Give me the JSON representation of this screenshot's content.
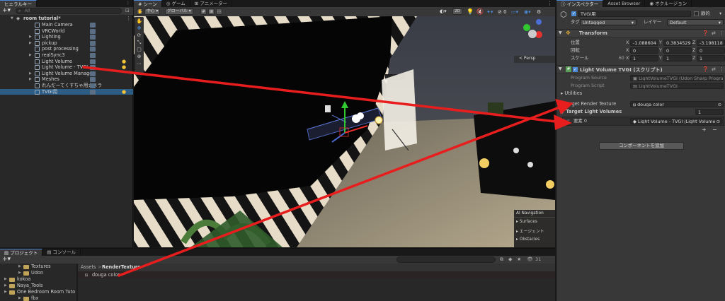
{
  "hierarchy": {
    "tab": "ヒエラルキー",
    "search_placeholder": "All",
    "scene_name": "room tutorial*",
    "items": [
      {
        "label": "Main Camera",
        "indent": 2,
        "fold": "",
        "bulb": false
      },
      {
        "label": "VRCWorld",
        "indent": 2,
        "fold": "",
        "bulb": false
      },
      {
        "label": "Lighting",
        "indent": 2,
        "fold": "▶",
        "bulb": false
      },
      {
        "label": "pickup",
        "indent": 2,
        "fold": "▶",
        "bulb": false
      },
      {
        "label": "post processing",
        "indent": 2,
        "fold": "",
        "bulb": false
      },
      {
        "label": "realSync3",
        "indent": 2,
        "fold": "▶",
        "bulb": false
      },
      {
        "label": "Light Volume",
        "indent": 2,
        "fold": "",
        "bulb": true
      },
      {
        "label": "Light Volume - TVGI",
        "indent": 2,
        "fold": "",
        "bulb": true
      },
      {
        "label": "Light Volume Manager",
        "indent": 2,
        "fold": "▶",
        "bulb": false
      },
      {
        "label": "Meshes",
        "indent": 2,
        "fold": "▶",
        "bulb": false
      },
      {
        "label": "れんだーてくすちゃ用カメラ",
        "indent": 2,
        "fold": "",
        "bulb": false
      },
      {
        "label": "TVGI用",
        "indent": 2,
        "fold": "",
        "bulb": true,
        "selected": true
      }
    ]
  },
  "scene": {
    "tabs": [
      "シーン",
      "ゲーム",
      "アニメーター"
    ],
    "toolbar": {
      "pivot": "中心",
      "space": "グローバル",
      "mode_2d": "2D"
    },
    "persp_label": "< Persp",
    "ai_nav": {
      "title": "AI Navigation",
      "items": [
        "Surfaces",
        "エージェント",
        "Obstacles"
      ]
    }
  },
  "inspector": {
    "tabs": [
      "インスペクター",
      "Asset Browser",
      "オクルージョン"
    ],
    "object_name": "TVGI用",
    "static_label": "静的",
    "tag_label": "タグ",
    "tag_value": "Untagged",
    "layer_label": "レイヤー",
    "layer_value": "Default",
    "transform": {
      "title": "Transform",
      "position_label": "位置",
      "rotation_label": "回転",
      "scale_label": "スケール",
      "position": [
        "-1.088604",
        "0.3834529",
        "-3.198118"
      ],
      "rotation": [
        "0",
        "0",
        "0"
      ],
      "scale": [
        "1",
        "1",
        "1"
      ],
      "scale_prefix": "60",
      "axes": [
        "X",
        "Y",
        "Z"
      ]
    },
    "component": {
      "title": "Light Volume TVGI (スクリプト)",
      "program_source_label": "Program Source",
      "program_source_value": "LightVolumeTVGI (Udon Sharp Progra",
      "program_script_label": "Program Script",
      "program_script_value": "LightVolumeTVGI",
      "utilities_label": "Utilities",
      "target_rt_label": "Target Render Texture",
      "target_rt_value": "douga color",
      "target_lv_label": "Target Light Volumes",
      "target_lv_count": "1",
      "element_label": "要素 0",
      "element_value": "Light Volume - TVGI (Light Volume"
    },
    "add_component": "コンポーネントを追加"
  },
  "project": {
    "tabs": [
      "プロジェクト",
      "コンソール"
    ],
    "tree": [
      {
        "label": "Textures",
        "indent": 2
      },
      {
        "label": "Udon",
        "indent": 2
      },
      {
        "label": "kokoa",
        "indent": 0
      },
      {
        "label": "Naya_Tools",
        "indent": 0
      },
      {
        "label": "One Bedroom Room Tuto",
        "indent": 0
      },
      {
        "label": "fbx",
        "indent": 2
      }
    ],
    "breadcrumb": [
      "Assets",
      "RenderTexture"
    ],
    "asset": "douga color",
    "count": "31"
  },
  "colors": {
    "accent": "#2c5d87",
    "arrow": "#e81d1d",
    "panel": "#383838"
  }
}
